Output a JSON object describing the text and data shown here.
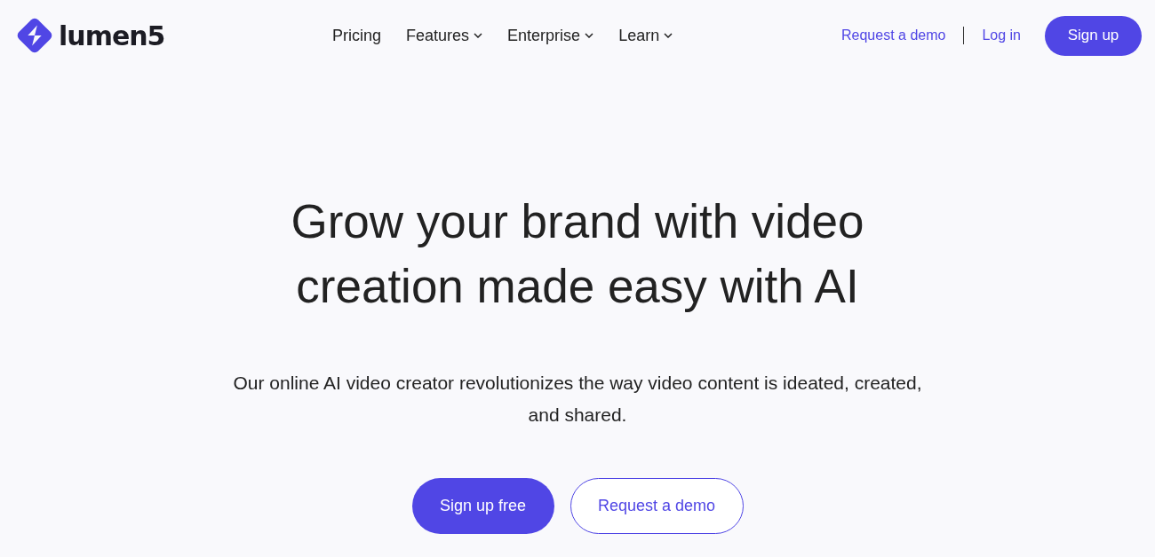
{
  "header": {
    "logo": {
      "text": "lumen5"
    },
    "nav": [
      {
        "label": "Pricing",
        "kind": "link"
      },
      {
        "label": "Features",
        "kind": "menu"
      },
      {
        "label": "Enterprise",
        "kind": "menu"
      },
      {
        "label": "Learn",
        "kind": "menu"
      }
    ],
    "actions": [
      {
        "label": "Request a demo",
        "kind": "link"
      },
      {
        "label": "Log in",
        "kind": "link"
      },
      {
        "label": "Sign up",
        "kind": "primary"
      }
    ]
  },
  "hero": {
    "title": "Grow your brand with video creation made easy with AI",
    "subtitle": "Our online AI video creator revolutionizes the way video content is ideated, created, and shared.",
    "buttons": [
      {
        "label": "Sign up free",
        "kind": "primary"
      },
      {
        "label": "Request a demo",
        "kind": "outline"
      }
    ]
  }
}
